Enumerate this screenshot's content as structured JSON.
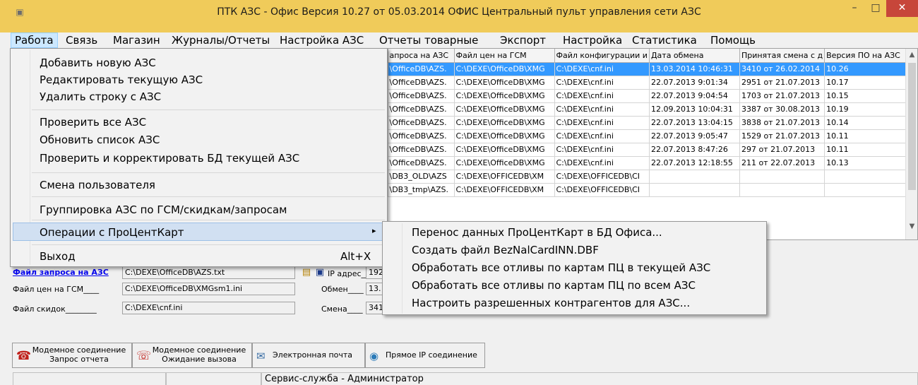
{
  "window": {
    "title": "ПТК АЗС - Офис Версия 10.27 от 05.03.2014 ОФИС Центральный пульт управления сети АЗС",
    "icon": "app-icon",
    "controls": {
      "minimize": "–",
      "maximize": "□",
      "close": "✕"
    }
  },
  "menubar": {
    "items": [
      "Работа",
      "Связь",
      "Магазин",
      "Журналы/Отчеты",
      "Настройка АЗС",
      "Отчеты товарные",
      "Экспорт",
      "Настройка",
      "Статистика",
      "Помощь"
    ],
    "active_index": 0
  },
  "grid": {
    "columns": [
      "апроса на АЗС",
      "Файл цен на ГСМ",
      "Файл конфигурации и",
      "Дата обмена",
      "Принятая смена с д",
      "Версия ПО на АЗС"
    ],
    "rows": [
      [
        "\\OfficeDB\\AZS.",
        "C:\\DEXE\\OfficeDB\\XMG",
        "C:\\DEXE\\cnf.ini",
        "13.03.2014 10:46:31",
        "3410 от 26.02.2014",
        "10.26"
      ],
      [
        "\\OfficeDB\\AZS.",
        "C:\\DEXE\\OfficeDB\\XMG",
        "C:\\DEXE\\cnf.ini",
        "22.07.2013 9:01:34",
        "2951 от 21.07.2013",
        "10.17"
      ],
      [
        "\\OfficeDB\\AZS.",
        "C:\\DEXE\\OfficeDB\\XMG",
        "C:\\DEXE\\cnf.ini",
        "22.07.2013 9:04:54",
        "1703 от 21.07.2013",
        "10.15"
      ],
      [
        "\\OfficeDB\\AZS.",
        "C:\\DEXE\\OfficeDB\\XMG",
        "C:\\DEXE\\cnf.ini",
        "12.09.2013 10:04:31",
        "3387 от 30.08.2013",
        "10.19"
      ],
      [
        "\\OfficeDB\\AZS.",
        "C:\\DEXE\\OfficeDB\\XMG",
        "C:\\DEXE\\cnf.ini",
        "22.07.2013 13:04:15",
        "3838 от 21.07.2013",
        "10.14"
      ],
      [
        "\\OfficeDB\\AZS.",
        "C:\\DEXE\\OfficeDB\\XMG",
        "C:\\DEXE\\cnf.ini",
        "22.07.2013 9:05:47",
        "1529 от 21.07.2013",
        "10.11"
      ],
      [
        "\\OfficeDB\\AZS.",
        "C:\\DEXE\\OfficeDB\\XMG",
        "C:\\DEXE\\cnf.ini",
        "22.07.2013 8:47:26",
        "297 от 21.07.2013",
        "10.11"
      ],
      [
        "\\OfficeDB\\AZS.",
        "C:\\DEXE\\OfficeDB\\XMG",
        "C:\\DEXE\\cnf.ini",
        "22.07.2013 12:18:55",
        "211 от 22.07.2013",
        "10.13"
      ],
      [
        "\\DB3_OLD\\AZS",
        "C:\\DEXE\\OFFICEDB\\XM",
        "C:\\DEXE\\OFFICEDB\\CI",
        "",
        "",
        ""
      ],
      [
        "\\DB3_tmp\\AZS.",
        "C:\\DEXE\\OFFICEDB\\XM",
        "C:\\DEXE\\OFFICEDB\\CI",
        "",
        "",
        ""
      ]
    ],
    "selected_row": 0
  },
  "form": {
    "request_label": "Файл запроса на АЗС",
    "request_value": "C:\\DEXE\\OfficeDB\\AZS.txt",
    "prices_label": "Файл цен на ГСМ____",
    "prices_value": "C:\\DEXE\\OfficeDB\\XMGsm1.ini",
    "discounts_label": "Файл скидок________",
    "discounts_value": "C:\\DEXE\\cnf.ini",
    "ip_label": "IP адрес__",
    "ip_value": "192",
    "exchange_label": "Обмен____",
    "exchange_value": "13.",
    "shift_label": "Смена____",
    "shift_value": "341"
  },
  "buttons": {
    "modem_report": "Модемное соединение Запрос отчета",
    "modem_wait": "Модемное соединение Ожидание вызова",
    "email": "Электронная почта",
    "direct_ip": "Прямое IP соединение"
  },
  "statusbar": {
    "user": "Сервис-служба - Администратор"
  },
  "menu_work": {
    "groups": [
      [
        "Добавить новую АЗС",
        "Редактировать текущую АЗС",
        "Удалить строку с АЗС"
      ],
      [
        "Проверить все АЗС",
        "Обновить список АЗС",
        "Проверить и корректировать БД текущей АЗС"
      ],
      [
        "Смена пользователя"
      ],
      [
        "Группировка АЗС по ГСМ/скидкам/запросам"
      ],
      [
        "Операции с ПроЦентКарт"
      ],
      [
        "Выход"
      ]
    ],
    "exit_shortcut": "Alt+X",
    "submenu_arrow": "▸"
  },
  "submenu_procentcart": {
    "items": [
      "Перенос данных ПроЦентКарт в БД Офиса...",
      "Создать файл BezNalCardINN.DBF",
      "Обработать все отливы по картам ПЦ в текущей АЗС",
      "Обработать все отливы по картам ПЦ по всем АЗС",
      "Настроить разрешенных контрагентов для АЗС..."
    ]
  },
  "colors": {
    "titlebar": "#f0cb5a",
    "selection": "#3399ff",
    "menu_highlight": "#d1e0f2",
    "close_button": "#c7463a",
    "link": "#0000ee"
  }
}
